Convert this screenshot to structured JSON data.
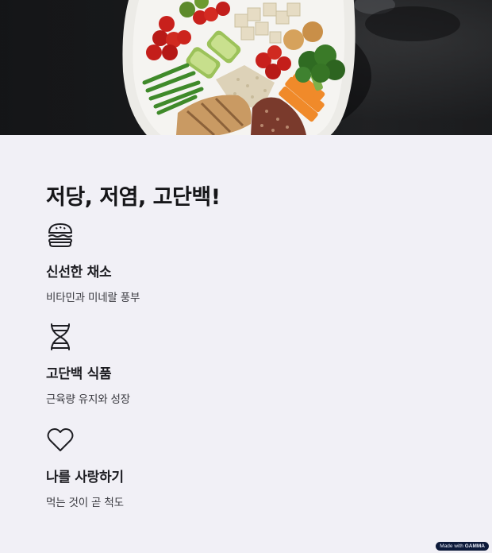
{
  "hero": {
    "image": "food-plate-photo"
  },
  "heading": "저당, 저염, 고단백!",
  "features": [
    {
      "icon": "burger-icon",
      "title": "신선한 채소",
      "description": "비타민과 미네랄 풍부"
    },
    {
      "icon": "dna-icon",
      "title": "고단백 식품",
      "description": "근육량 유지와 성장"
    },
    {
      "icon": "heart-icon",
      "title": "나를 사랑하기",
      "description": "먹는 것이 곧 척도"
    }
  ],
  "badge": {
    "prefix": "Made with",
    "brand": "GAMMA"
  }
}
